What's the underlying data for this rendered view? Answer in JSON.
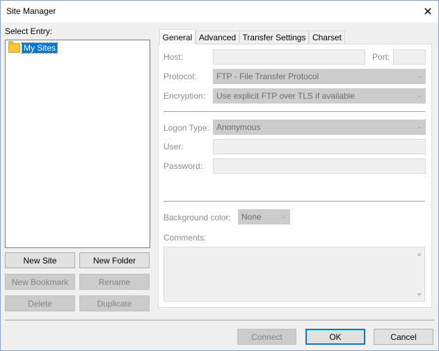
{
  "window": {
    "title": "Site Manager"
  },
  "left": {
    "select_entry_label": "Select Entry:",
    "tree": [
      {
        "label": "My Sites",
        "icon": "folder-icon",
        "selected": true
      }
    ],
    "buttons": {
      "new_site": "New Site",
      "new_folder": "New Folder",
      "new_bookmark": "New Bookmark",
      "rename": "Rename",
      "delete": "Delete",
      "duplicate": "Duplicate"
    }
  },
  "tabs": [
    "General",
    "Advanced",
    "Transfer Settings",
    "Charset"
  ],
  "general": {
    "host_label": "Host:",
    "host_value": "",
    "port_label": "Port:",
    "port_value": "",
    "protocol_label": "Protocol:",
    "protocol_value": "FTP - File Transfer Protocol",
    "encryption_label": "Encryption:",
    "encryption_value": "Use explicit FTP over TLS if available",
    "logon_type_label": "Logon Type:",
    "logon_type_value": "Anonymous",
    "user_label": "User:",
    "user_value": "",
    "password_label": "Password:",
    "password_value": "",
    "background_color_label": "Background color:",
    "background_color_value": "None",
    "comments_label": "Comments:",
    "comments_value": ""
  },
  "footer": {
    "connect": "Connect",
    "ok": "OK",
    "cancel": "Cancel"
  },
  "colors": {
    "selection": "#0078d7",
    "disabled_text": "#8c8c8c",
    "folder": "#f5c542"
  }
}
